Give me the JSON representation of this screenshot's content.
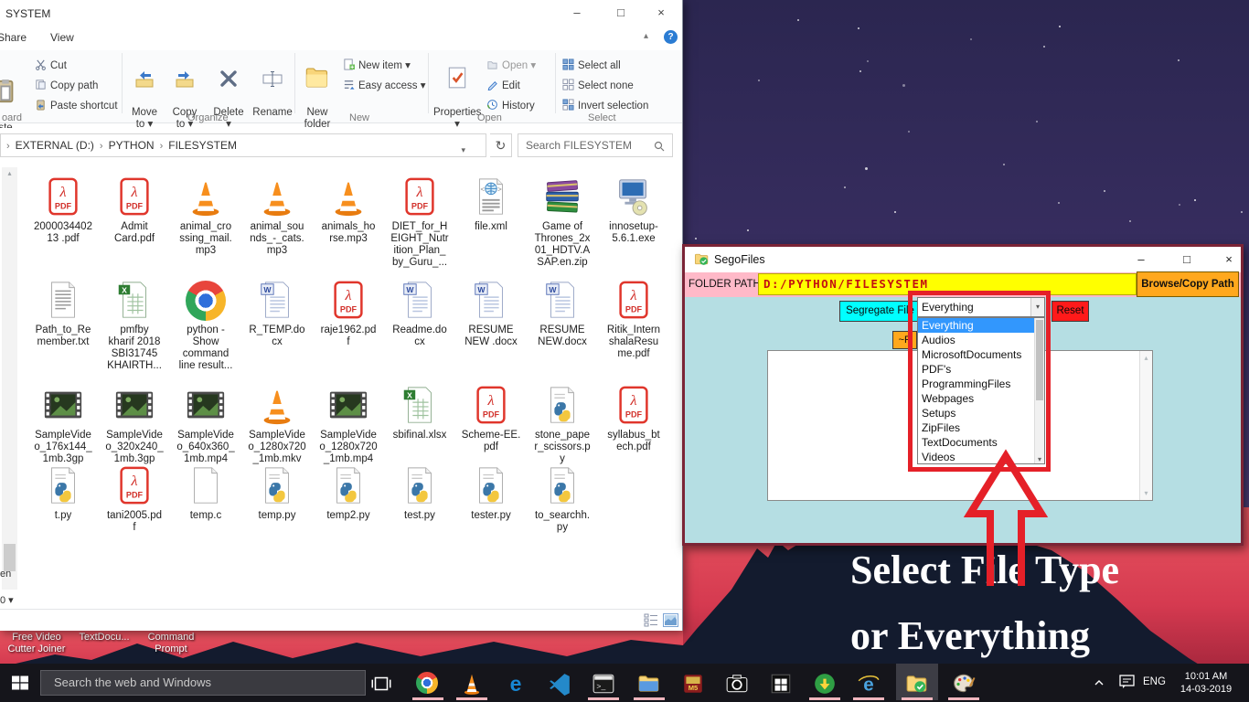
{
  "explorer": {
    "title": "SYSTEM",
    "tabs": [
      "Share",
      "View"
    ],
    "window_buttons": {
      "minimize": "–",
      "maximize": "□",
      "close": "×"
    },
    "ribbon": {
      "paste_partial": "ste",
      "cut": "Cut",
      "copy_path": "Copy path",
      "paste_shortcut": "Paste shortcut",
      "move_to": "Move\nto ▾",
      "copy_to": "Copy\nto ▾",
      "delete": "Delete\n▾",
      "rename": "Rename",
      "new_folder": "New\nfolder",
      "new_item": "New item ▾",
      "easy_access": "Easy access ▾",
      "properties": "Properties\n▾",
      "open": "Open ▾",
      "edit": "Edit",
      "history": "History",
      "select_all": "Select all",
      "select_none": "Select none",
      "invert_selection": "Invert selection",
      "groups": [
        "oard",
        "Organize",
        "New",
        "Open",
        "Select"
      ]
    },
    "breadcrumb": [
      "EXTERNAL (D:)",
      "PYTHON",
      "FILESYSTEM"
    ],
    "search_placeholder": "Search FILESYSTEM",
    "nav_fragments": {
      "a": "en",
      "b": "0 ▾"
    },
    "files": {
      "rows": [
        [
          {
            "type": "pdf",
            "label": "2000034402\n13 .pdf"
          },
          {
            "type": "pdf",
            "label": "Admit\nCard.pdf"
          },
          {
            "type": "vlc",
            "label": "animal_cro\nssing_mail.\nmp3"
          },
          {
            "type": "vlc",
            "label": "animal_sou\nnds_-_cats.\nmp3"
          },
          {
            "type": "vlc",
            "label": "animals_ho\nrse.mp3"
          },
          {
            "type": "pdf",
            "label": "DIET_for_H\nEIGHT_Nutr\nition_Plan_\nby_Guru_..."
          },
          {
            "type": "xml",
            "label": "file.xml"
          },
          {
            "type": "rar",
            "label": "Game of\nThrones_2x\n01_HDTV.A\nSAP.en.zip"
          },
          {
            "type": "exe",
            "label": "innosetup-\n5.6.1.exe"
          }
        ],
        [
          {
            "type": "txt",
            "label": "Path_to_Re\nmember.txt"
          },
          {
            "type": "xls",
            "label": "pmfby\nkharif 2018\nSBI31745\nKHAIRTH..."
          },
          {
            "type": "chrome",
            "label": "python -\nShow\ncommand\nline result..."
          },
          {
            "type": "doc",
            "label": "R_TEMP.do\ncx"
          },
          {
            "type": "pdf",
            "label": "raje1962.pd\nf"
          },
          {
            "type": "doc",
            "label": "Readme.do\ncx"
          },
          {
            "type": "doc",
            "label": "RESUME\nNEW .docx"
          },
          {
            "type": "doc",
            "label": "RESUME\nNEW.docx"
          },
          {
            "type": "pdf",
            "label": "Ritik_Intern\nshalaResu\nme.pdf"
          }
        ],
        [
          {
            "type": "film",
            "label": "SampleVide\no_176x144_\n1mb.3gp"
          },
          {
            "type": "film",
            "label": "SampleVide\no_320x240_\n1mb.3gp"
          },
          {
            "type": "film",
            "label": "SampleVide\no_640x360_\n1mb.mp4"
          },
          {
            "type": "vlc",
            "label": "SampleVide\no_1280x720\n_1mb.mkv"
          },
          {
            "type": "film",
            "label": "SampleVide\no_1280x720\n_1mb.mp4"
          },
          {
            "type": "xls",
            "label": "sbifinal.xlsx"
          },
          {
            "type": "pdf",
            "label": "Scheme-EE.\npdf"
          },
          {
            "type": "py",
            "label": "stone_pape\nr_scissors.p\ny"
          },
          {
            "type": "pdf",
            "label": "syllabus_bt\nech.pdf"
          }
        ],
        [
          {
            "type": "py",
            "label": "t.py"
          },
          {
            "type": "pdf",
            "label": "tani2005.pd\nf"
          },
          {
            "type": "c",
            "label": "temp.c"
          },
          {
            "type": "py",
            "label": "temp.py"
          },
          {
            "type": "py",
            "label": "temp2.py"
          },
          {
            "type": "py",
            "label": "test.py"
          },
          {
            "type": "py",
            "label": "tester.py"
          },
          {
            "type": "py",
            "label": "to_searchh.\npy"
          }
        ]
      ]
    }
  },
  "sego": {
    "title": "SegoFiles",
    "window_buttons": {
      "minimize": "–",
      "maximize": "□",
      "close": "×"
    },
    "path_label": "FOLDER PATH >",
    "path_value": "D:/PYTHON/FILESYSTEM",
    "browse_button": "Browse/Copy Path",
    "segregate_button": "Segregate File",
    "reset_button": "Reset",
    "partial_button": "~P",
    "dropdown_value": "Everything",
    "dropdown_options": [
      "Everything",
      "Audios",
      "MicrosoftDocuments",
      "PDF's",
      "ProgrammingFiles",
      "Webpages",
      "Setups",
      "ZipFiles",
      "TextDocuments",
      "Videos"
    ],
    "colors": {
      "body": "#b5dee3",
      "path_label_bg": "#ffb9c8",
      "path_field_bg": "#ffff00",
      "path_text": "#c31111",
      "browse_bg": "#ffa81d",
      "segregate_bg": "#00ffff",
      "reset_bg": "#ff1a1a",
      "selected_option_bg": "#3297fd",
      "annotation_red": "#e52028",
      "window_border": "#7b2436"
    }
  },
  "desktop": {
    "caption": "Select File Type\nor Everything",
    "shortcuts": {
      "a": "Free Video\nCutter Joiner",
      "b": "TextDocu...",
      "c": "Command\nPrompt"
    }
  },
  "taskbar": {
    "search_placeholder": "Search the web and Windows",
    "icons": [
      {
        "icon": "task-view",
        "name": "task-view-button",
        "underline": false,
        "active": false
      },
      {
        "icon": "chrome",
        "name": "chrome",
        "underline": true,
        "active": false
      },
      {
        "icon": "vlc",
        "name": "vlc",
        "underline": true,
        "active": false
      },
      {
        "icon": "edge",
        "name": "edge",
        "underline": false,
        "active": false
      },
      {
        "icon": "vscode",
        "name": "vscode",
        "underline": false,
        "active": false
      },
      {
        "icon": "cmd",
        "name": "command-prompt",
        "underline": true,
        "active": false
      },
      {
        "icon": "explorer",
        "name": "file-explorer",
        "underline": true,
        "active": false
      },
      {
        "icon": "media",
        "name": "media-app",
        "underline": false,
        "active": false
      },
      {
        "icon": "camera",
        "name": "camera-app",
        "underline": false,
        "active": false
      },
      {
        "icon": "store",
        "name": "microsoft-store",
        "underline": false,
        "active": false
      },
      {
        "icon": "idm",
        "name": "download-manager",
        "underline": true,
        "active": false
      },
      {
        "icon": "ie",
        "name": "internet-explorer",
        "underline": true,
        "active": false
      },
      {
        "icon": "segofiles",
        "name": "segofiles-app",
        "underline": true,
        "active": true
      },
      {
        "icon": "paint",
        "name": "paint",
        "underline": true,
        "active": false
      }
    ],
    "tray": {
      "lang": "ENG",
      "time": "10:01 AM",
      "date": "14-03-2019"
    }
  }
}
